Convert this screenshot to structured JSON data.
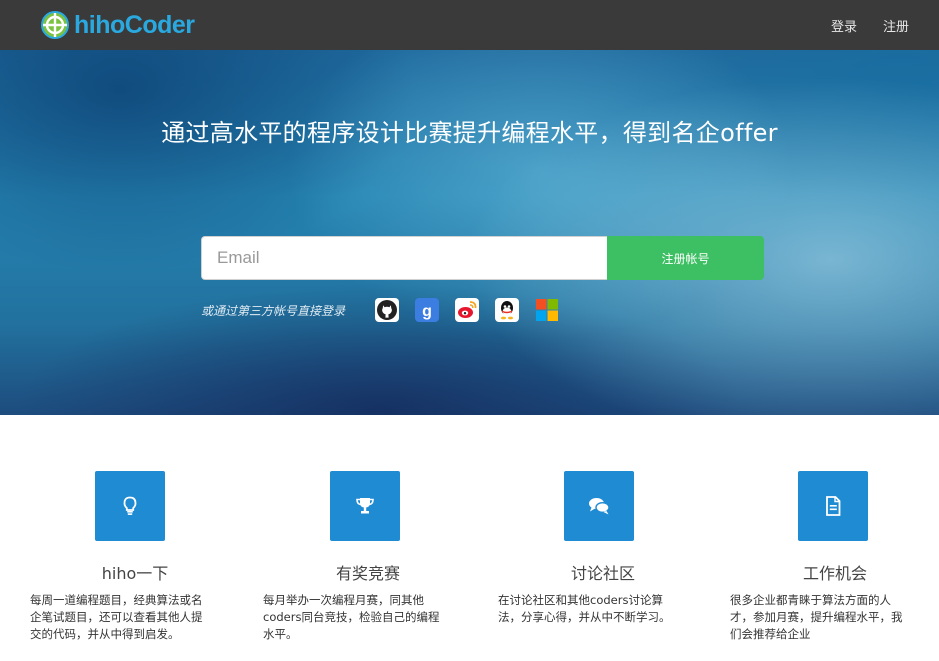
{
  "nav": {
    "logo_text": "hihoCoder",
    "login_label": "登录",
    "register_label": "注册"
  },
  "hero": {
    "title": "通过高水平的程序设计比赛提升编程水平，得到名企offer",
    "email_placeholder": "Email",
    "register_button": "注册帐号",
    "third_party_label": "或通过第三方帐号直接登录",
    "social_icons": [
      "github-icon",
      "google-icon",
      "weibo-icon",
      "qq-icon",
      "microsoft-icon"
    ]
  },
  "features": [
    {
      "icon": "lightbulb-icon",
      "title": "hiho一下",
      "desc_lines": [
        "每周一道编程题目，经典算法或名",
        "企笔试题目，还可以查看其他人提",
        "交的代码，并从中得到启发。"
      ]
    },
    {
      "icon": "trophy-icon",
      "title": "有奖竞赛",
      "desc_lines": [
        "每月举办一次编程月赛，同其他",
        "coders同台竞技，检验自己的编程",
        "水平。"
      ]
    },
    {
      "icon": "chat-bubbles-icon",
      "title": "讨论社区",
      "desc_lines": [
        "在讨论社区和其他coders讨论算",
        "法，分享心得，并从中不断学习。"
      ]
    },
    {
      "icon": "document-icon",
      "title": "工作机会",
      "desc_lines": [
        "很多企业都青睐于算法方面的人",
        "才，参加月赛，提升编程水平，我",
        "们会推荐给企业"
      ]
    }
  ],
  "colors": {
    "navbar": "#3a3a3a",
    "logo": "#2aa9e0",
    "register_button": "#3dbf63",
    "feature_icon_box": "#1f8bd3"
  }
}
